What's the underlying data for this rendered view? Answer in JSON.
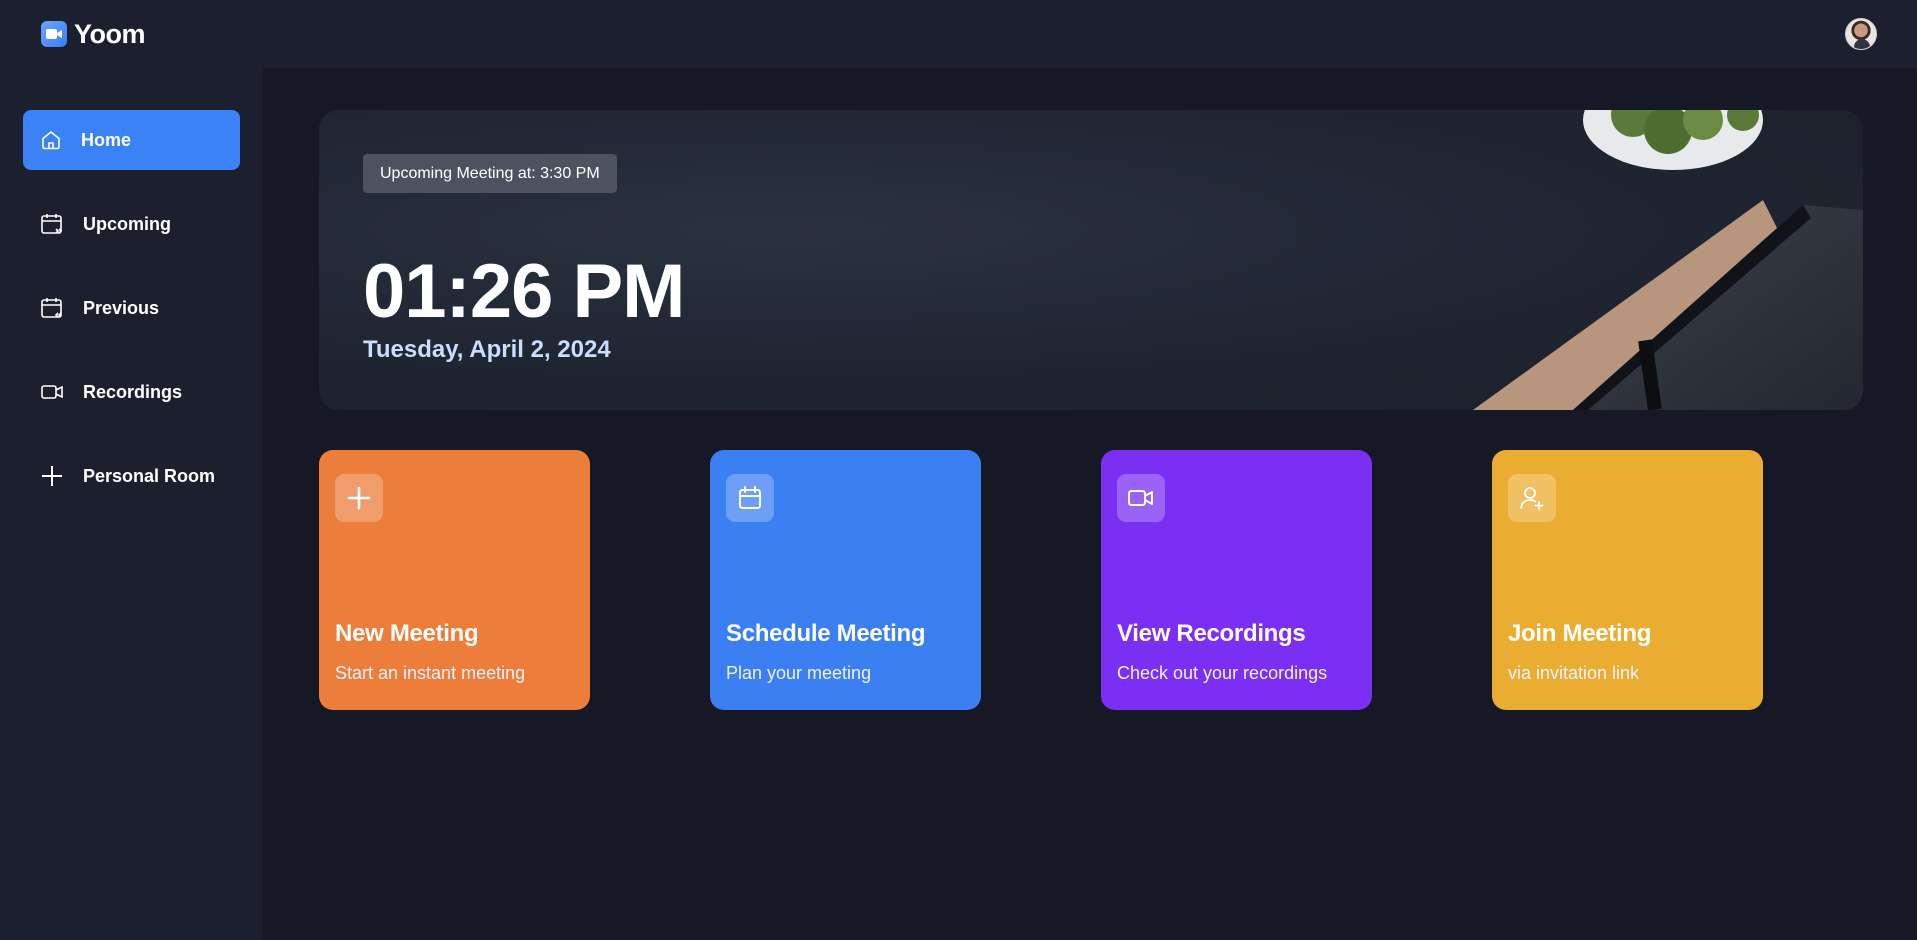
{
  "app": {
    "name": "Yoom"
  },
  "colors": {
    "accent": "#3b82f6",
    "orange": "#ec7d3a",
    "blue": "#3b7ff2",
    "purple": "#7a2ff2",
    "yellow": "#ebac32"
  },
  "sidebar": {
    "items": [
      {
        "label": "Home",
        "icon": "home-icon",
        "active": true
      },
      {
        "label": "Upcoming",
        "icon": "calendar-upcoming-icon",
        "active": false
      },
      {
        "label": "Previous",
        "icon": "calendar-previous-icon",
        "active": false
      },
      {
        "label": "Recordings",
        "icon": "video-icon",
        "active": false
      },
      {
        "label": "Personal Room",
        "icon": "plus-icon",
        "active": false
      }
    ]
  },
  "hero": {
    "badge": "Upcoming Meeting at: 3:30 PM",
    "time": "01:26 PM",
    "date": "Tuesday, April 2, 2024"
  },
  "cards": [
    {
      "title": "New Meeting",
      "subtitle": "Start an instant meeting",
      "icon": "plus-icon"
    },
    {
      "title": "Schedule Meeting",
      "subtitle": "Plan your meeting",
      "icon": "calendar-icon"
    },
    {
      "title": "View Recordings",
      "subtitle": "Check out your recordings",
      "icon": "video-icon"
    },
    {
      "title": "Join Meeting",
      "subtitle": "via invitation link",
      "icon": "user-plus-icon"
    }
  ]
}
